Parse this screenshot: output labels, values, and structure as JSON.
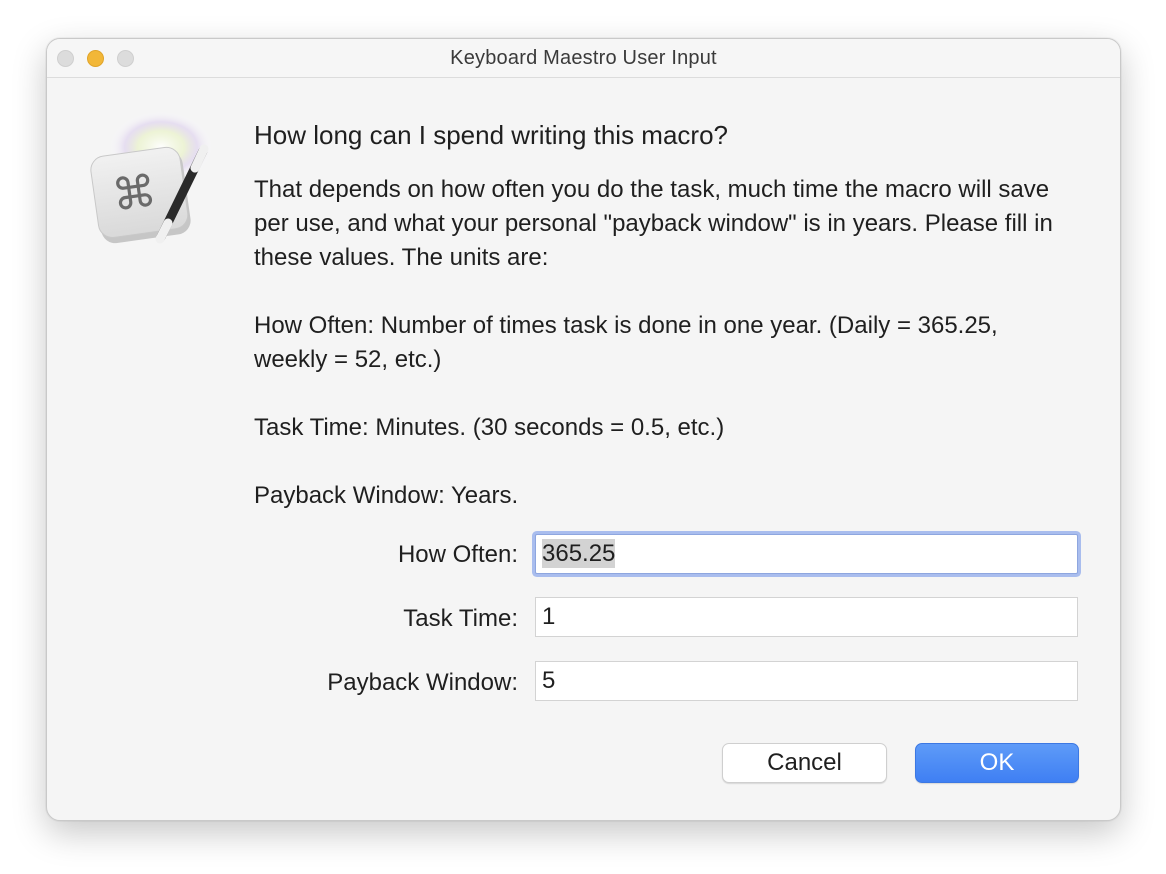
{
  "window": {
    "title": "Keyboard Maestro User Input"
  },
  "icon": {
    "name": "keyboard-maestro-app-icon",
    "glyph": "⌘"
  },
  "prompt": {
    "heading": "How long can I spend writing this macro?",
    "paragraph1": "That depends on how often you do the task, much time the macro will save per use, and what your personal \"payback window\" is in years. Please fill in these values. The units are:",
    "paragraph2": "How Often: Number of times task is done in one year. (Daily = 365.25, weekly = 52, etc.)",
    "paragraph3": "Task Time: Minutes. (30 seconds = 0.5, etc.)",
    "paragraph4": "Payback Window: Years."
  },
  "fields": {
    "how_often": {
      "label": "How Often:",
      "value": "365.25"
    },
    "task_time": {
      "label": "Task Time:",
      "value": "1"
    },
    "payback_window": {
      "label": "Payback Window:",
      "value": "5"
    }
  },
  "buttons": {
    "cancel": "Cancel",
    "ok": "OK"
  },
  "colors": {
    "accent": "#3f7ff3",
    "focus_ring": "#a9bdee",
    "minimize": "#f2b738"
  }
}
